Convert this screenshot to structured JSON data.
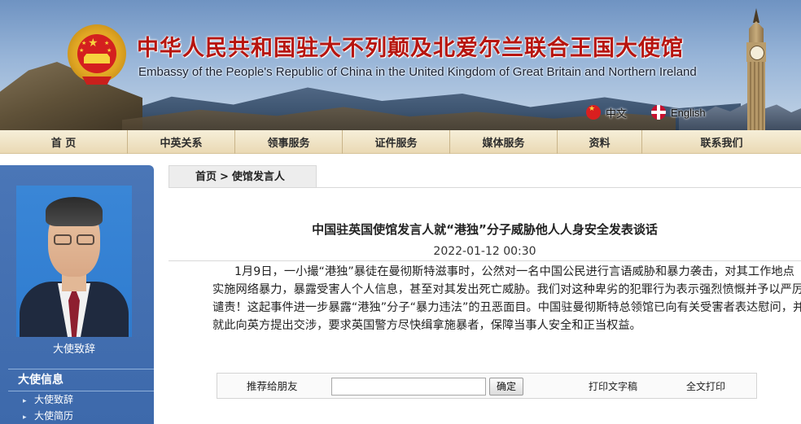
{
  "header": {
    "title_cn": "中华人民共和国驻大不列颠及北爱尔兰联合王国大使馆",
    "title_en": "Embassy of the People's Republic of China in the United Kingdom of Great Britain and Northern Ireland",
    "lang_cn": "中文",
    "lang_en": "English"
  },
  "nav": {
    "items": [
      {
        "label": "首 页"
      },
      {
        "label": "中英关系"
      },
      {
        "label": "领事服务"
      },
      {
        "label": "证件服务"
      },
      {
        "label": "媒体服务"
      },
      {
        "label": "资料"
      },
      {
        "label": "联系我们"
      }
    ]
  },
  "sidebar": {
    "ambassador_label": "大使致辞",
    "section_title": "大使信息",
    "links": [
      {
        "label": "大使致辞"
      },
      {
        "label": "大使简历"
      }
    ]
  },
  "breadcrumb": {
    "home": "首页",
    "separator": ">",
    "current": "使馆发言人"
  },
  "article": {
    "title": "中国驻英国使馆发言人就“港独”分子威胁他人人身安全发表谈话",
    "date": "2022-01-12 00:30",
    "body": "1月9日，一小撮“港独”暴徒在曼彻斯特滋事时，公然对一名中国公民进行言语威胁和暴力袭击，对其工作地点实施网络暴力，暴露受害人个人信息，甚至对其发出死亡威胁。我们对这种卑劣的犯罪行为表示强烈愤慨并予以严厉谴责！这起事件进一步暴露“港独”分子“暴力违法”的丑恶面目。中国驻曼彻斯特总领馆已向有关受害者表达慰问，并就此向英方提出交涉，要求英国警方尽快缉拿施暴者，保障当事人安全和正当权益。"
  },
  "share": {
    "label": "推荐给朋友",
    "input_value": "",
    "button": "确定",
    "print_text": "打印文字稿",
    "print_full": "全文打印"
  },
  "colors": {
    "title_red": "#b7150f",
    "nav_bg": "#ead9b4",
    "sidebar_blue": "#3d69ab"
  }
}
